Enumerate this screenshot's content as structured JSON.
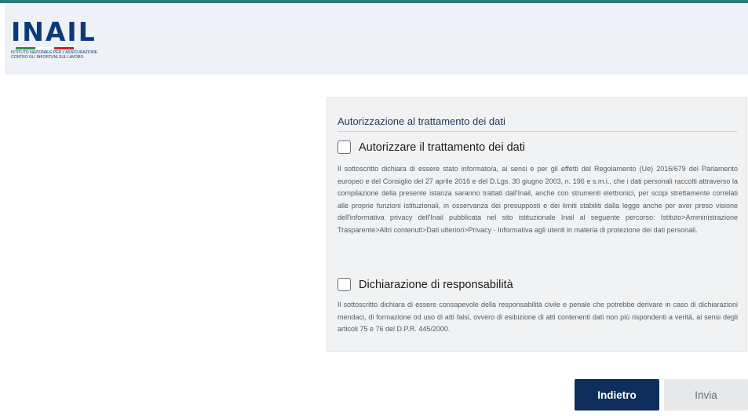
{
  "brand": {
    "name": "INAIL",
    "subtitle_line1": "ISTITUTO NAZIONALE PER L'ASSICURAZIONE",
    "subtitle_line2": "CONTRO GLI INFORTUNI SUL LAVORO"
  },
  "colors": {
    "accent_bar": "#2b7b78",
    "primary": "#0d2e5a",
    "logo": "#0b3a7a"
  },
  "section": {
    "title": "Autorizzazione al trattamento dei dati",
    "items": [
      {
        "label": "Autorizzare il trattamento dei dati",
        "checked": false,
        "text": "Il sottoscritto dichiara di essere stato informato/a, ai sensi e per gli effetti del Regolamento (Ue) 2016/679 del Parlamento europeo e del Consiglio del 27 aprile 2016 e del D.Lgs. 30 giugno 2003, n. 196 e s.m.i., che i dati personali raccolti attraverso la compilazione della presente istanza saranno trattati dall'Inail, anche con strumenti elettronici, per scopi strettamente correlati alle proprie funzioni istituzionali, in osservanza dei presupposti e dei limiti stabiliti dalla legge anche per aver preso visione dell'informativa privacy dell'Inail pubblicata nel sito istituzionale Inail al seguente percorso: Istituto>Amministrazione Trasparente>Altri contenuti>Dati ulteriori>Privacy - Informativa agli utenti in materia di protezione dei dati personali."
      },
      {
        "label": "Dichiarazione di responsabilità",
        "checked": false,
        "text": "Il sottoscritto dichiara di essere consapevole della responsabilità civile e penale che potrebbe derivare in caso di dichiarazioni mendaci, di formazione od uso di atti falsi, ovvero di esibizione di atti contenenti dati non più rispondenti a verità, ai sensi degli articoli 75 e 76 del D.P.R. 445/2000."
      }
    ]
  },
  "actions": {
    "back_label": "Indietro",
    "send_label": "Invia"
  }
}
